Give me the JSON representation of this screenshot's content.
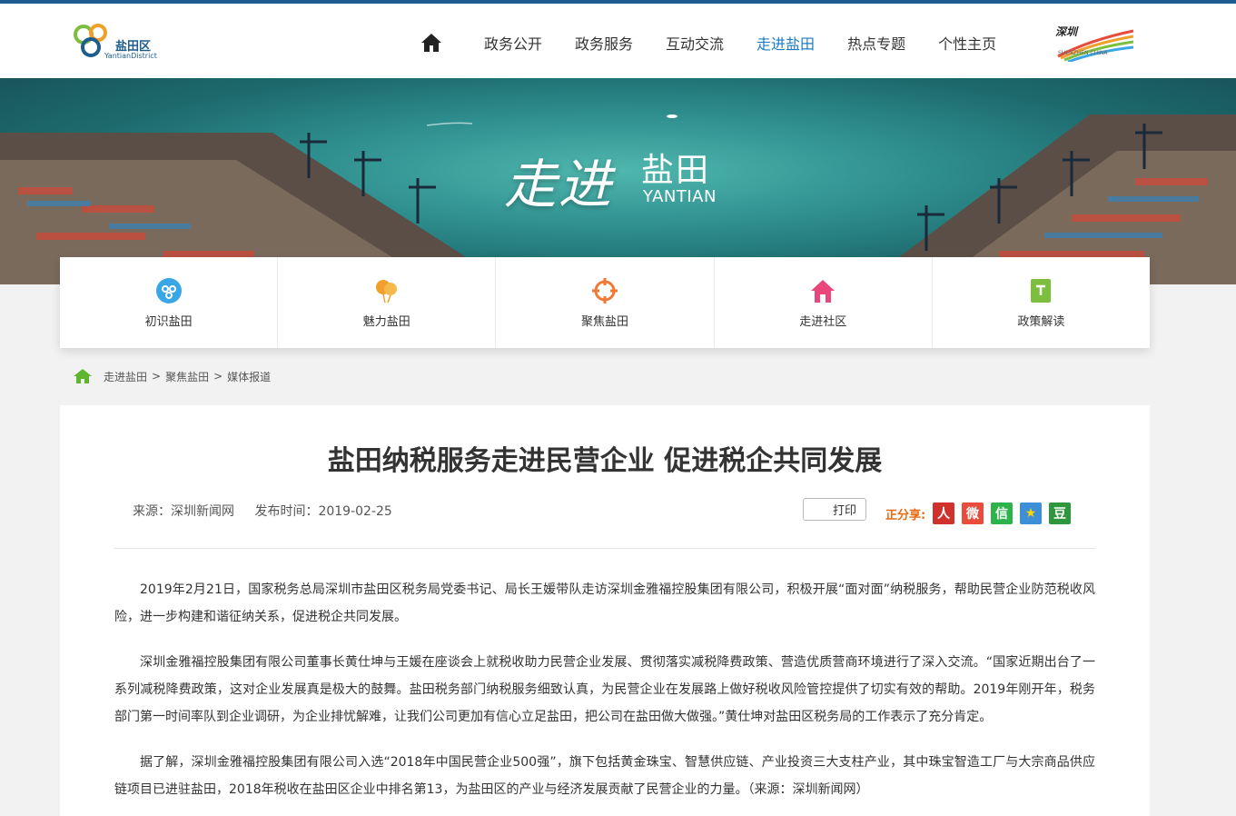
{
  "header": {
    "logo_text": "盐田区",
    "logo_sub": "YantianDistrict",
    "nav": [
      "政务公开",
      "政务服务",
      "互动交流",
      "走进盐田",
      "热点专题",
      "个性主页"
    ],
    "active_nav": "走进盐田",
    "sz_logo_text": "深圳",
    "sz_logo_sub": "SHENZHEN CHINA"
  },
  "banner": {
    "title_script": "走进",
    "title_main": "盐田",
    "title_en": "YANTIAN"
  },
  "quick_links": [
    {
      "label": "初识盐田",
      "icon": "circle-network-icon",
      "color": "#3aa6e6"
    },
    {
      "label": "魅力盐田",
      "icon": "balloons-icon",
      "color": "#f0a02a"
    },
    {
      "label": "聚焦盐田",
      "icon": "crosshair-icon",
      "color": "#f07a33"
    },
    {
      "label": "走进社区",
      "icon": "house-icon",
      "color": "#e9477b"
    },
    {
      "label": "政策解读",
      "icon": "document-icon",
      "color": "#7cbf3f"
    }
  ],
  "breadcrumb": [
    "走进盐田",
    "聚焦盐田",
    "媒体报道"
  ],
  "breadcrumb_sep": ">",
  "article": {
    "title": "盐田纳税服务走进民营企业 促进税企共同发展",
    "source": "来源：深圳新闻网",
    "published": "发布时间：2019-02-25",
    "print_label": "打印",
    "share_label": "正分享:",
    "share_icons": [
      {
        "name": "renren-share-icon",
        "glyph": "人",
        "color": "#d0312d"
      },
      {
        "name": "weibo-share-icon",
        "glyph": "微",
        "color": "#e74c3c"
      },
      {
        "name": "wechat-share-icon",
        "glyph": "信",
        "color": "#2db34a"
      },
      {
        "name": "qzone-share-icon",
        "glyph": "★",
        "color": "#3d8fd8"
      },
      {
        "name": "douban-share-icon",
        "glyph": "豆",
        "color": "#2e963d"
      }
    ],
    "paragraphs": [
      "2019年2月21日，国家税务总局深圳市盐田区税务局党委书记、局长王媛带队走访深圳金雅福控股集团有限公司，积极开展“面对面”纳税服务，帮助民营企业防范税收风险，进一步构建和谐征纳关系，促进税企共同发展。",
      "深圳金雅福控股集团有限公司董事长黄仕坤与王媛在座谈会上就税收助力民营企业发展、贯彻落实减税降费政策、营造优质营商环境进行了深入交流。“国家近期出台了一系列减税降费政策，这对企业发展真是极大的鼓舞。盐田税务部门纳税服务细致认真，为民营企业在发展路上做好税收风险管控提供了切实有效的帮助。2019年刚开年，税务部门第一时间率队到企业调研，为企业排忧解难，让我们公司更加有信心立足盐田，把公司在盐田做大做强。”黄仕坤对盐田区税务局的工作表示了充分肯定。",
      "据了解，深圳金雅福控股集团有限公司入选“2018年中国民营企业500强”，旗下包括黄金珠宝、智慧供应链、产业投资三大支柱产业，其中珠宝智造工厂与大宗商品供应链项目已进驻盐田，2018年税收在盐田区企业中排名第13，为盐田区的产业与经济发展贡献了民营企业的力量。（来源：深圳新闻网）"
    ]
  }
}
